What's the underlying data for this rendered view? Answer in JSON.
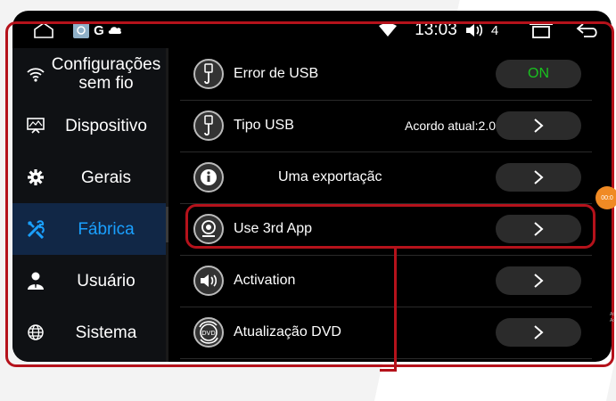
{
  "status_bar": {
    "time": "13:03",
    "volume_level": "4",
    "app_badge_letter": "G",
    "icons": [
      "home-icon",
      "gallery-icon",
      "cloud-icon",
      "wifi-icon",
      "volume-icon",
      "recent-apps-icon",
      "back-icon"
    ]
  },
  "sidebar": {
    "items": [
      {
        "label": "Configurações sem fio",
        "icon": "wifi-icon",
        "active": false
      },
      {
        "label": "Dispositivo",
        "icon": "monitor-icon",
        "active": false
      },
      {
        "label": "Gerais",
        "icon": "gear-icon",
        "active": false
      },
      {
        "label": "Fábrica",
        "icon": "tools-icon",
        "active": true
      },
      {
        "label": "Usuário",
        "icon": "user-icon",
        "active": false
      },
      {
        "label": "Sistema",
        "icon": "globe-icon",
        "active": false
      }
    ]
  },
  "settings": {
    "rows": [
      {
        "label": "Error de USB",
        "icon": "usb-icon",
        "value": "",
        "control": "ON"
      },
      {
        "label": "Tipo USB",
        "icon": "usb-icon",
        "value": "Acordo atual:2.0",
        "control": ">"
      },
      {
        "label": "Uma exportaçãc",
        "icon": "info-icon",
        "value": "",
        "control": ">"
      },
      {
        "label": "Use 3rd App",
        "icon": "camera-icon",
        "value": "",
        "control": ">"
      },
      {
        "label": "Activation",
        "icon": "speaker-icon",
        "value": "",
        "control": ">"
      },
      {
        "label": "Atualização DVD",
        "icon": "dvd-icon",
        "value": "",
        "control": ">"
      }
    ]
  },
  "floating_button": {
    "text": "00:0"
  },
  "watermark": {
    "lines": [
      "At",
      "Ac"
    ]
  },
  "colors": {
    "accent": "#1aa0ff",
    "on": "#19c21f",
    "highlight": "#b5121b",
    "floating": "#f08a24"
  }
}
